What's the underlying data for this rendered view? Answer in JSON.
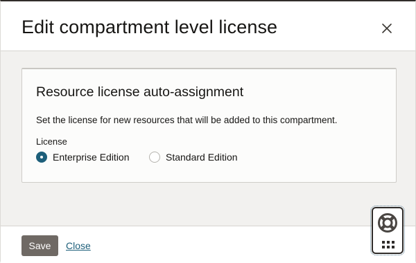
{
  "dialog": {
    "title": "Edit compartment level license",
    "close_icon": "close-icon"
  },
  "card": {
    "title": "Resource license auto-assignment",
    "description": "Set the license for new resources that will be added to this compartment.",
    "license_label": "License",
    "options": [
      {
        "label": "Enterprise Edition",
        "selected": true
      },
      {
        "label": "Standard Edition",
        "selected": false
      }
    ]
  },
  "footer": {
    "save_label": "Save",
    "close_label": "Close"
  },
  "help_widget": {
    "icons": [
      "lifebuoy-icon",
      "grid-dots-icon"
    ]
  },
  "colors": {
    "accent": "#1d5f7a",
    "save_button": "#6f6964",
    "top_border": "#312d2a"
  }
}
